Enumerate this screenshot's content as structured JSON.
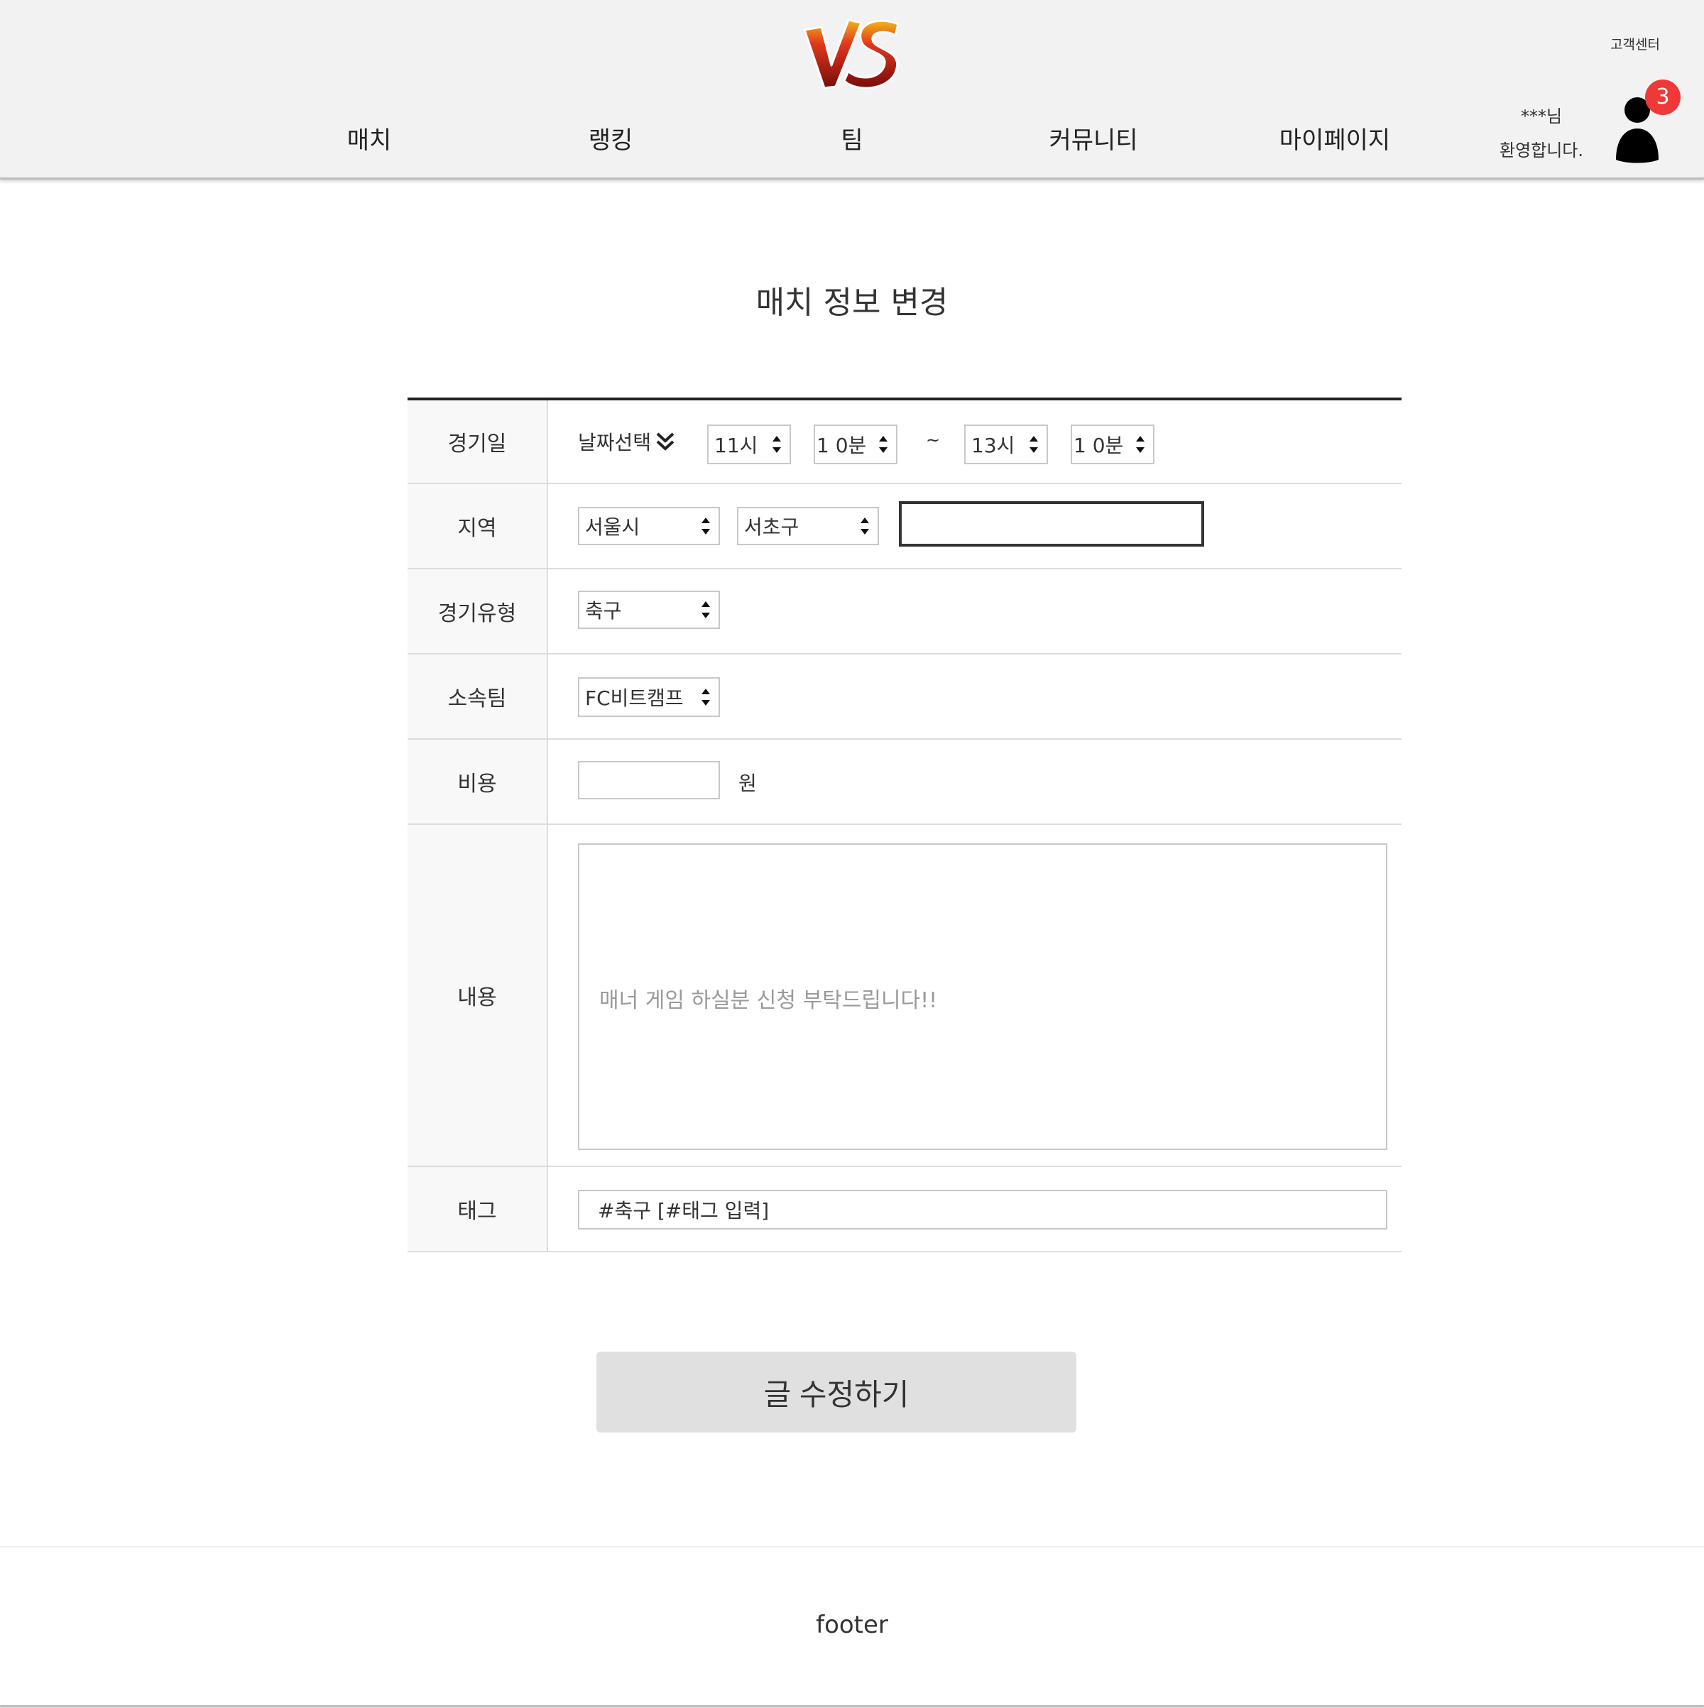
{
  "header": {
    "logo_text": "VS",
    "customer_center": "고객센터",
    "nav": [
      "매치",
      "랭킹",
      "팀",
      "커뮤니티",
      "마이페이지"
    ],
    "welcome_line1": "***님",
    "welcome_line2": "환영합니다.",
    "notification_count": "3"
  },
  "page_title": "매치 정보 변경",
  "form": {
    "date": {
      "label": "경기일",
      "date_picker": "날짜선택",
      "start_hour": "11시",
      "start_minute": "1 0분",
      "separator": "~",
      "end_hour": "13시",
      "end_minute": "1 0분"
    },
    "region": {
      "label": "지역",
      "city": "서울시",
      "district": "서초구",
      "detail_value": ""
    },
    "match_type": {
      "label": "경기유형",
      "value": "축구"
    },
    "team": {
      "label": "소속팀",
      "value": "FC비트캠프"
    },
    "cost": {
      "label": "비용",
      "value": "",
      "unit": "원"
    },
    "content": {
      "label": "내용",
      "placeholder": "매너 게임 하실분 신청 부탁드립니다!!"
    },
    "tags": {
      "label": "태그",
      "value": "#축구 [#태그 입력]"
    }
  },
  "submit_label": "글 수정하기",
  "footer_text": "footer"
}
